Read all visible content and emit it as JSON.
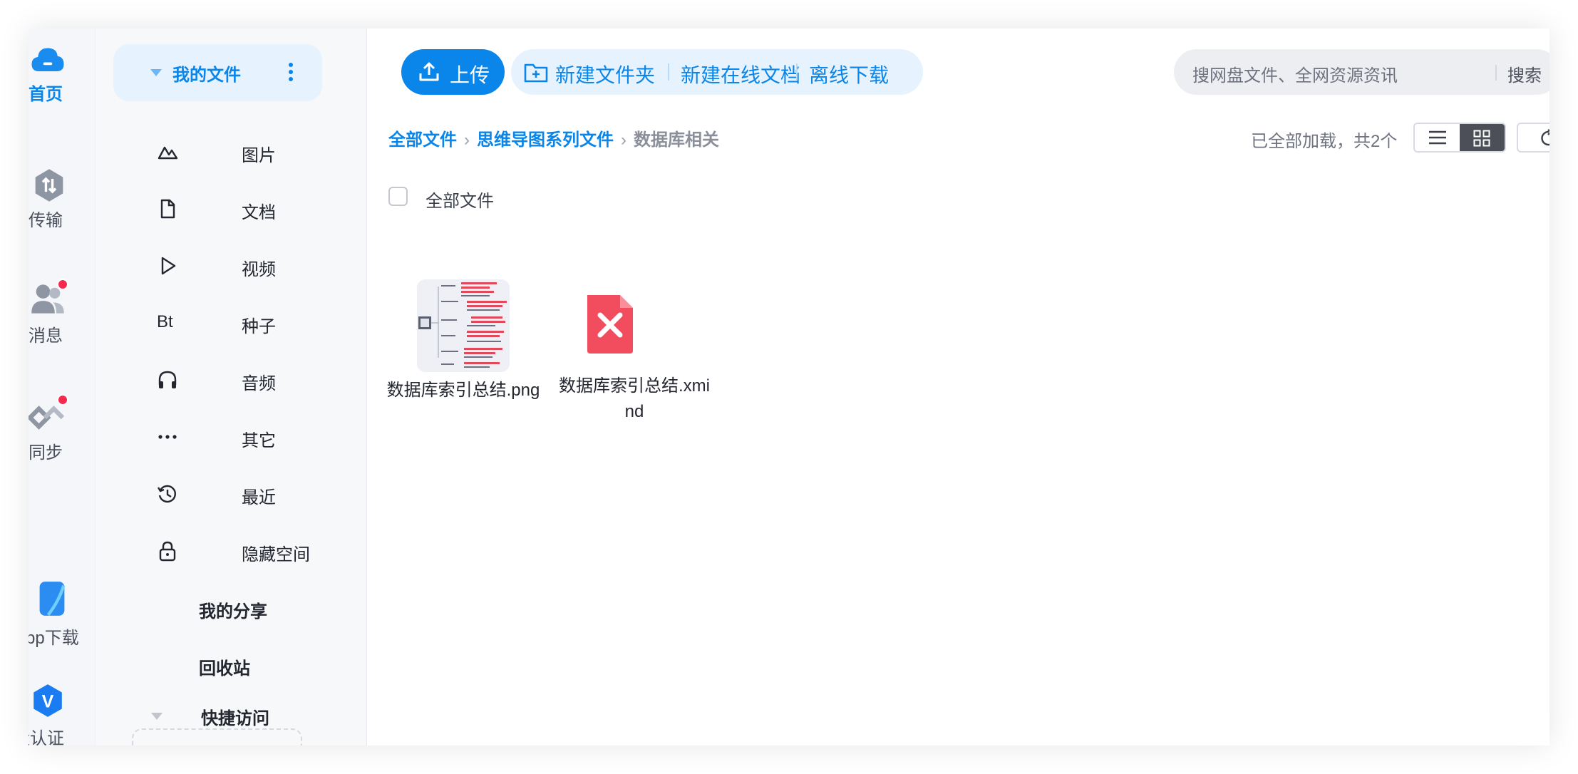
{
  "rail": {
    "items": [
      {
        "label": "首页",
        "icon": "cloud-icon"
      },
      {
        "label": "传输",
        "icon": "transfer-icon"
      },
      {
        "label": "消息",
        "icon": "users-icon"
      },
      {
        "label": "同步",
        "icon": "sync-icon"
      },
      {
        "label": "App下载",
        "icon": "phone-icon"
      },
      {
        "label": "网盘认证",
        "icon": "verify-icon"
      }
    ]
  },
  "sidebar": {
    "my_files": "我的文件",
    "items": [
      {
        "label": "图片",
        "icon": "image-icon"
      },
      {
        "label": "文档",
        "icon": "document-icon"
      },
      {
        "label": "视频",
        "icon": "play-icon"
      },
      {
        "label": "种子",
        "icon": "bt-icon",
        "icon_text": "Bt"
      },
      {
        "label": "音频",
        "icon": "headphones-icon"
      },
      {
        "label": "其它",
        "icon": "ellipsis-icon"
      },
      {
        "label": "最近",
        "icon": "history-icon"
      },
      {
        "label": "隐藏空间",
        "icon": "lock-icon"
      },
      {
        "label": "我的分享"
      },
      {
        "label": "回收站"
      }
    ],
    "quick_access": "快捷访问"
  },
  "toolbar": {
    "upload": "上传",
    "new_folder": "新建文件夹",
    "new_doc": "新建在线文档",
    "offline": "离线下载"
  },
  "search": {
    "placeholder": "搜网盘文件、全网资源资讯",
    "button": "搜索"
  },
  "breadcrumb": [
    "全部文件",
    "思维导图系列文件",
    "数据库相关"
  ],
  "status": "已全部加载，共2个",
  "select_all": "全部文件",
  "files": [
    {
      "name": "数据库索引总结.png",
      "type": "image"
    },
    {
      "name": "数据库索引总结.xmind",
      "type": "xmind"
    }
  ],
  "colors": {
    "accent": "#0a85e9",
    "badge": "#f5294f",
    "xmind": "#f24d5e"
  }
}
